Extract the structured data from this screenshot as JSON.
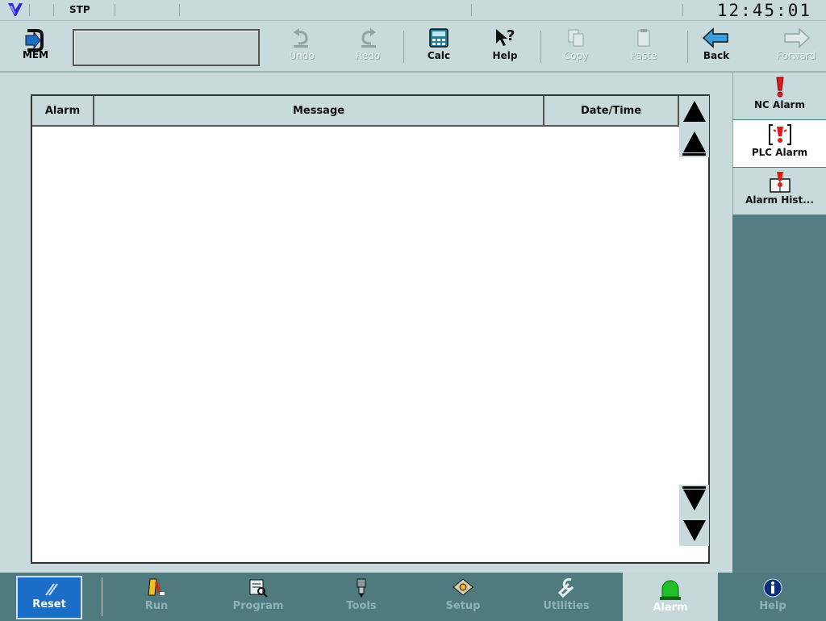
{
  "status": {
    "mode": "STP",
    "time": "12:45:01"
  },
  "toolbar": {
    "mem_label": "MEM",
    "undo_label": "Undo",
    "redo_label": "Redo",
    "calc_label": "Calc",
    "help_label": "Help",
    "copy_label": "Copy",
    "paste_label": "Paste",
    "back_label": "Back",
    "forward_label": "Forward"
  },
  "alarm_table": {
    "columns": [
      "Alarm",
      "Message",
      "Date/Time"
    ],
    "rows": []
  },
  "side_tabs": [
    {
      "label": "NC Alarm",
      "icon": "exclamation-icon"
    },
    {
      "label": "PLC Alarm",
      "icon": "plc-alarm-icon",
      "active": true
    },
    {
      "label": "Alarm Hist...",
      "icon": "alarm-history-icon"
    }
  ],
  "navbar": {
    "reset_label": "Reset",
    "run_label": "Run",
    "program_label": "Program",
    "tools_label": "Tools",
    "setup_label": "Setup",
    "utilities_label": "Utilities",
    "alarm_label": "Alarm",
    "help_label": "Help"
  },
  "colors": {
    "panel": "#c9dadc",
    "nav_bg": "#4f7a7e",
    "reset_blue": "#1c6dc7",
    "alarm_red": "#e01b1b",
    "alarm_green": "#1fbf2a"
  }
}
